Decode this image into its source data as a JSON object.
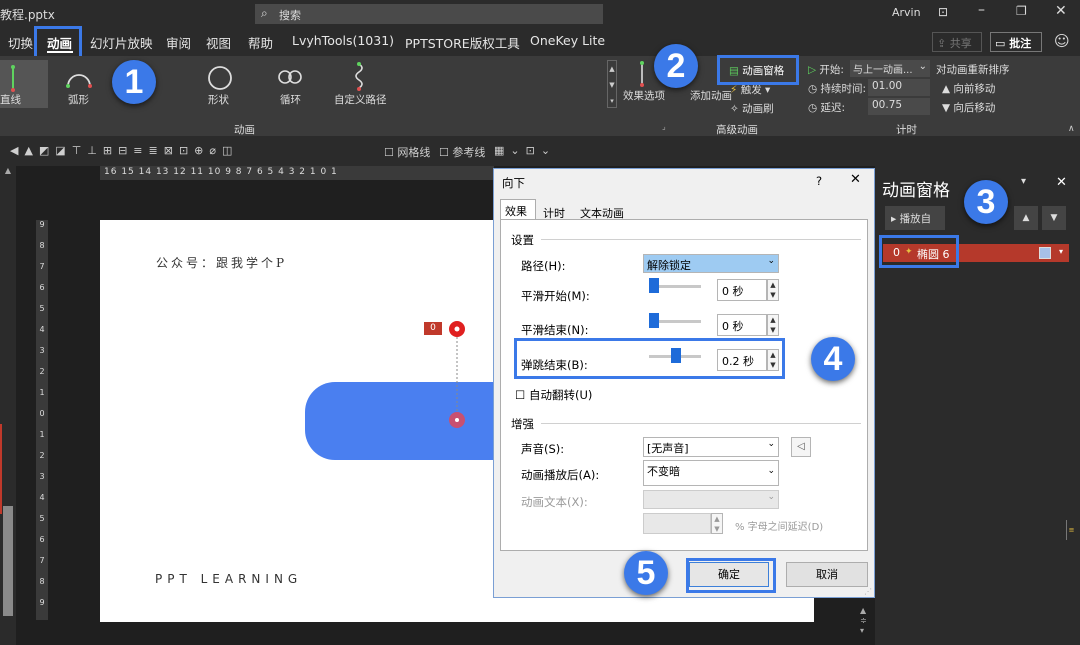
{
  "titlebar": {
    "filename": "教程.pptx",
    "search": "搜索",
    "user": "Arvin"
  },
  "tabs": [
    "切换",
    "动画",
    "幻灯片放映",
    "审阅",
    "视图",
    "帮助",
    "LvyhTools(1031)",
    "PPTSTORE版权工具",
    "OneKey Lite"
  ],
  "share": {
    "share_label": "共享",
    "comment_label": "批注"
  },
  "ribbon": {
    "paths": [
      "直线",
      "弧形",
      "形状",
      "循环",
      "自定义路径"
    ],
    "group_animation": "动画",
    "effect_options": "效果选项",
    "add_animation": "添加动画",
    "anim_pane": "动画窗格",
    "trigger": "触发",
    "anim_painter": "动画刷",
    "group_advanced": "高级动画",
    "start_label": "开始:",
    "start_value": "与上一动画...",
    "duration_label": "持续时间:",
    "duration_value": "01.00",
    "delay_label": "延迟:",
    "delay_value": "00.75",
    "reorder": "对动画重新排序",
    "move_earlier": "向前移动",
    "move_later": "向后移动",
    "group_timing": "计时"
  },
  "toolbar2": {
    "gridlines": "网格线",
    "guides": "参考线"
  },
  "ruler": "16 15 14 13 12 11 10 9 8 7 6 5 4 3 2 1 0 1",
  "vruler": [
    "9",
    "8",
    "7",
    "6",
    "5",
    "4",
    "3",
    "2",
    "1",
    "0",
    "1",
    "2",
    "3",
    "4",
    "5",
    "6",
    "7",
    "8",
    "9"
  ],
  "slide": {
    "header_text": "公众号：跟我学个P",
    "footer_text": "PPT LEARNING",
    "tag_number": "0"
  },
  "panel": {
    "title": "动画窗格",
    "play_from": "播放自",
    "item_index": "0",
    "item_name": "椭圆 6"
  },
  "dialog": {
    "title": "向下",
    "help": "?",
    "tabs": [
      "效果",
      "计时",
      "文本动画"
    ],
    "section_settings": "设置",
    "path_label": "路径(H):",
    "path_value": "解除锁定",
    "smooth_start_label": "平滑开始(M):",
    "smooth_start_value": "0 秒",
    "smooth_end_label": "平滑结束(N):",
    "smooth_end_value": "0 秒",
    "bounce_end_label": "弹跳结束(B):",
    "bounce_end_value": "0.2 秒",
    "auto_reverse": "自动翻转(U)",
    "section_enhance": "增强",
    "sound_label": "声音(S):",
    "sound_value": "[无声音]",
    "after_anim_label": "动画播放后(A):",
    "after_anim_value": "不变暗",
    "anim_text_label": "动画文本(X):",
    "letter_delay": "% 字母之间延迟(D)",
    "ok": "确定",
    "cancel": "取消"
  },
  "badges": [
    "1",
    "2",
    "3",
    "4",
    "5"
  ],
  "colors": {
    "accent": "#3b79e8",
    "shape": "#4a7ff0",
    "anim_item": "#b5392b",
    "tag": "#c0392b"
  }
}
